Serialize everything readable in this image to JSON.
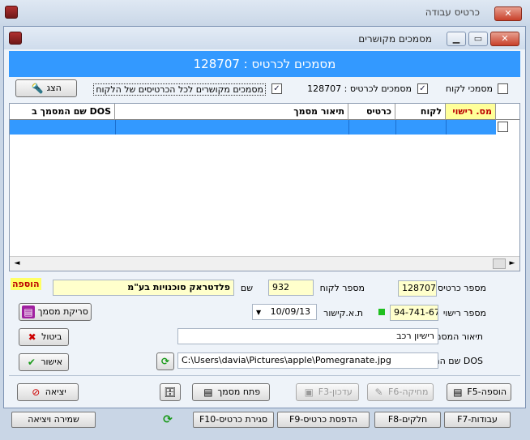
{
  "outer_window": {
    "title": "כרטיס עבודה"
  },
  "inner_window": {
    "title": "מסמכים מקושרים"
  },
  "banner": {
    "text": "מסמכים לכרטיס : 128707"
  },
  "filters": {
    "customer_docs_label": "מסמכי לקוח",
    "customer_docs_checked": false,
    "card_docs_label": "מסמכים לכרטיס : 128707",
    "card_docs_checked": true,
    "all_cards_label": "מסמכים מקושרים לכל הכרטיסים של הלקוח",
    "all_cards_checked": true,
    "show_button": "הצג"
  },
  "grid": {
    "columns": [
      "מס. רישוי",
      "לקוח",
      "כרטיס",
      "תיאור מסמך",
      "שם המסמך ב DOS"
    ],
    "rows": [
      {
        "license": "",
        "customer": "",
        "card": "",
        "description": "",
        "dos_name": ""
      }
    ]
  },
  "form": {
    "add_badge": "הוספה",
    "card_number_label": "מספר כרטיס",
    "card_number": "128707",
    "customer_number_label": "מספר לקוח",
    "customer_number": "932",
    "name_label": "שם",
    "customer_name": "פלדטראק סוכנויות בע\"מ",
    "license_label": "מספר רישוי",
    "license_number": "94-741-67",
    "license_date_label": "ת.א.קישור",
    "license_date": "10/09/13",
    "doc_description_label": "תיאור המסמך",
    "doc_description": "רישיון רכב",
    "dos_name_label": "שם המסמך ב DOS",
    "dos_path": "C:\\Users\\davia\\Pictures\\apple\\Pomegranate.jpg",
    "scan_button": "סריקת מסמך",
    "cancel_button": "ביטול",
    "confirm_button": "אישור"
  },
  "actions": {
    "add": "F5-הוספה",
    "delete": "F6-מחיקה",
    "update": "F3-עדכון",
    "open_doc": "פתח מסמך",
    "exit": "יציאה"
  },
  "background_bar": {
    "items": [
      "F7-עבודות",
      "F8-חלקים",
      "F9-הדפסת כרטיס",
      "F10-סגירת כרטיס",
      "שמירה ויציאה"
    ]
  },
  "colors": {
    "accent": "#3399ff",
    "highlight": "#ffff99",
    "header_text": "#b00000"
  }
}
